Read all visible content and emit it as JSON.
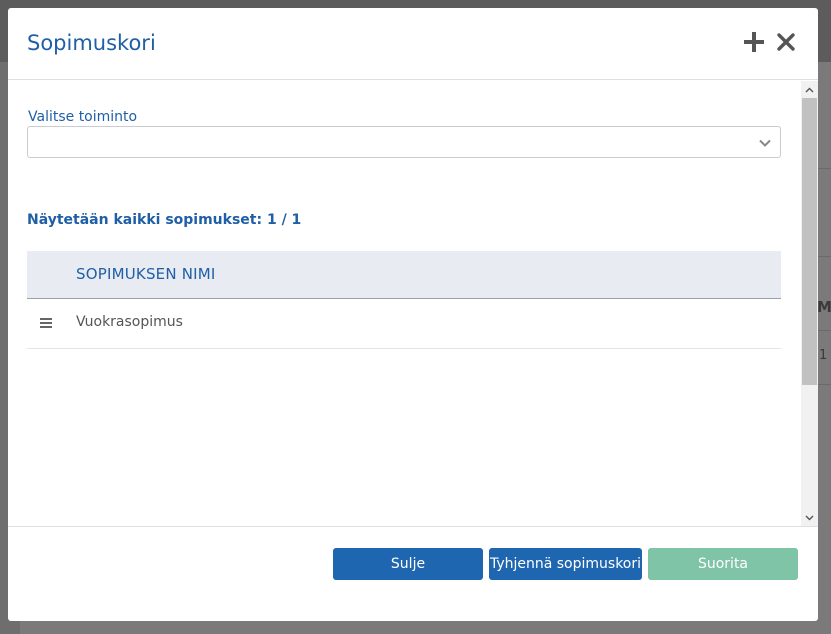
{
  "modal": {
    "title": "Sopimuskori",
    "icons": {
      "add": "plus-icon",
      "close": "close-icon"
    }
  },
  "action_select": {
    "label": "Valitse toiminto",
    "value": ""
  },
  "status": {
    "count_text": "Näytetään kaikki sopimukset: 1 / 1"
  },
  "table": {
    "columns": [
      "SOPIMUKSEN NIMI"
    ],
    "rows": [
      {
        "name": "Vuokrasopimus"
      }
    ]
  },
  "footer": {
    "close_label": "Sulje",
    "clear_label": "Tyhjennä sopimuskori",
    "run_label": "Suorita"
  },
  "background": {
    "peek_header": "M",
    "peek_cell": "1"
  },
  "colors": {
    "primary": "#1f66b1",
    "title": "#1f5fa6",
    "run_disabled": "#7fc4a6",
    "table_header_bg": "#e8ebf2"
  }
}
